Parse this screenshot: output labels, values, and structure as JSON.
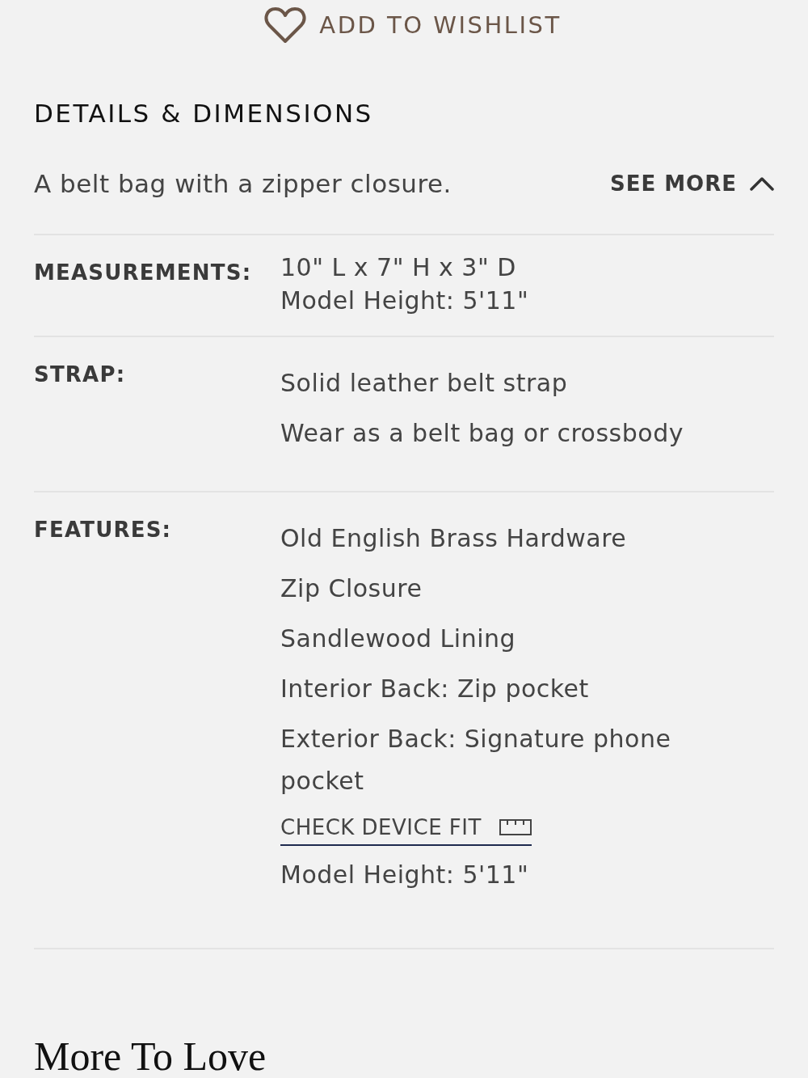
{
  "wishlist": {
    "label": "ADD TO WISHLIST"
  },
  "details": {
    "title": "DETAILS & DIMENSIONS",
    "description": "A belt bag with a zipper closure.",
    "toggle": {
      "label": "SEE MORE",
      "expanded": true
    },
    "rows": [
      {
        "label": "MEASUREMENTS:",
        "kind": "compact",
        "items": [
          {
            "kind": "text",
            "text": "10\" L x 7\" H x 3\" D"
          },
          {
            "kind": "text",
            "text": "Model Height: 5'11\""
          }
        ]
      },
      {
        "label": "STRAP:",
        "kind": "list",
        "items": [
          {
            "kind": "text",
            "text": "Solid leather belt strap"
          },
          {
            "kind": "text",
            "text": "Wear as a belt bag or crossbody"
          }
        ]
      },
      {
        "label": "FEATURES:",
        "kind": "list",
        "items": [
          {
            "kind": "text",
            "text": "Old English Brass Hardware"
          },
          {
            "kind": "text",
            "text": "Zip Closure"
          },
          {
            "kind": "text",
            "text": "Sandlewood Lining"
          },
          {
            "kind": "text",
            "text": "Interior Back: Zip pocket"
          },
          {
            "kind": "text",
            "text": "Exterior Back: Signature phone pocket"
          },
          {
            "kind": "link",
            "text": "CHECK DEVICE FIT"
          },
          {
            "kind": "text",
            "text": "Model Height: 5'11\""
          }
        ]
      }
    ]
  },
  "more_to_love": {
    "title": "More To Love"
  }
}
